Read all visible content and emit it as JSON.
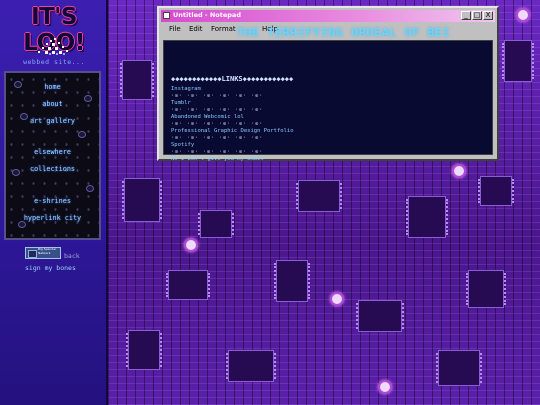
{
  "site": {
    "logo_text": "IT'S LOO!",
    "tagline": "webbed site..."
  },
  "nav": {
    "items": [
      {
        "label": "home"
      },
      {
        "label": "about"
      },
      {
        "label": "art gallery"
      },
      {
        "label": "elsewhere"
      },
      {
        "label": "collections"
      },
      {
        "label": "e-shrines"
      },
      {
        "label": "hyperlink city"
      }
    ],
    "badge_text": "Big Spender Network",
    "back_label": "back",
    "guestbook_label": "sign my bones"
  },
  "notepad": {
    "title": "Untitled - Notepad",
    "buttons": {
      "minimize": "_",
      "maximize": "□",
      "close": "X"
    },
    "menu": {
      "file": "File",
      "edit": "Edit",
      "format": "Format",
      "help": "Help"
    },
    "marquee": "THE TERRIFYING ORDEAL OF BEI",
    "links_header": "◆◆◆◆◆◆◆◆◆◆◆◆LINKS◆◆◆◆◆◆◆◆◆◆◆◆",
    "links": [
      {
        "label": "Instagram"
      },
      {
        "label": "Tumblr"
      },
      {
        "label": "Abandoned Webcomic lol"
      },
      {
        "label": "Professional Graphic Design Portfolio"
      },
      {
        "label": "Spotify"
      }
    ],
    "divider": "·⊙· ·⊙· ·⊙· ·⊙· ·⊙· ·⊙·",
    "footer_text": "No I won't give you my email"
  },
  "colors": {
    "sidebar": "#3018a0",
    "link": "#9ed4ff",
    "notepad_bg": "#080a32",
    "titlebar": "#d64ad0",
    "circuit": "#4a1896"
  }
}
